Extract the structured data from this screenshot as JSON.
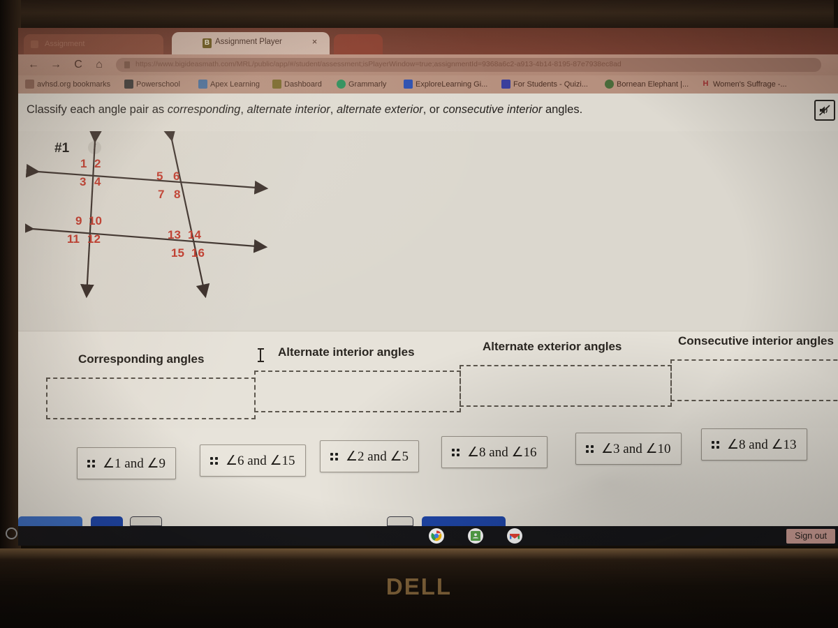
{
  "browser": {
    "background_tab_title": "Assignment",
    "active_tab_title": "Assignment Player",
    "active_tab_favicon_letter": "B",
    "close_label": "×",
    "back_icon": "←",
    "forward_icon": "→",
    "reload_icon": "C",
    "home_icon": "⌂",
    "url": "https://www.bigideasmath.com/MRL/public/app/#/student/assessment;isPlayerWindow=true;assignmentId=9368a6c2-a913-4b14-8195-87e7938ec8ad",
    "bookmarks": [
      {
        "label": "avhsd.org bookmarks",
        "icon": "folder-icon",
        "color": "#8a6152"
      },
      {
        "label": "Powerschool",
        "icon": "powerschool-icon",
        "color": "#3d3a38"
      },
      {
        "label": "Apex Learning",
        "icon": "apex-learning-icon",
        "color": "#4b6f9a"
      },
      {
        "label": "Dashboard",
        "icon": "dashboard-icon",
        "color": "#7b6a2c"
      },
      {
        "label": "Grammarly",
        "icon": "grammarly-icon",
        "color": "#2f8f5b"
      },
      {
        "label": "ExploreLearning Gi...",
        "icon": "explorelearning-icon",
        "color": "#2b4fb0"
      },
      {
        "label": "For Students - Quizi...",
        "icon": "quizizz-icon",
        "color": "#3a3f9c"
      },
      {
        "label": "Bornean Elephant |...",
        "icon": "elephant-icon",
        "color": "#4a6b3a"
      },
      {
        "label": "Women's Suffrage -...",
        "icon": "history-icon",
        "color": "#9c3030"
      }
    ]
  },
  "question": {
    "prompt_prefix": "Classify each angle pair as ",
    "term_1": "corresponding",
    "sep_1": ", ",
    "term_2": "alternate interior",
    "sep_2": ", ",
    "term_3": "alternate exterior",
    "sep_3": ", or ",
    "term_4": "consecutive interior",
    "prompt_suffix": " angles.",
    "number": "#1",
    "info_badge": "i",
    "mute_icon": "speaker-muted-icon"
  },
  "diagram": {
    "type": "two-parallel-lines-cut-by-two-transversals",
    "angle_labels": [
      "1",
      "2",
      "3",
      "4",
      "5",
      "6",
      "7",
      "8",
      "9",
      "10",
      "11",
      "12",
      "13",
      "14",
      "15",
      "16"
    ],
    "label_color": "#c0392b",
    "line_color": "#3a2f2a"
  },
  "categories": [
    {
      "title": "Corresponding angles",
      "dropped_tiles": []
    },
    {
      "title": "Alternate interior angles",
      "dropped_tiles": []
    },
    {
      "title": "Alternate exterior angles",
      "dropped_tiles": []
    },
    {
      "title": "Consecutive interior angles",
      "dropped_tiles": []
    }
  ],
  "tiles": [
    {
      "label": "∠1 and ∠9",
      "handle": "drag-handle"
    },
    {
      "label": "∠6 and ∠15",
      "handle": "drag-handle"
    },
    {
      "label": "∠2 and ∠5",
      "handle": "drag-handle"
    },
    {
      "label": "∠8 and ∠16",
      "handle": "drag-handle"
    },
    {
      "label": "∠3 and ∠10",
      "handle": "drag-handle"
    },
    {
      "label": "∠8 and ∠13",
      "handle": "drag-handle"
    }
  ],
  "shelf": {
    "apps": [
      {
        "name": "chrome-icon"
      },
      {
        "name": "classroom-icon"
      },
      {
        "name": "gmail-icon"
      }
    ],
    "sign_out_label": "Sign out"
  },
  "device": {
    "brand": "DELL"
  },
  "colors": {
    "accent_red": "#c0392b",
    "tab_strip": "#7a4133",
    "toolbar": "#b9907f",
    "page_bg": "#ddd9d0",
    "shelf": "#17171a",
    "signout_bg": "#d8a69d"
  }
}
